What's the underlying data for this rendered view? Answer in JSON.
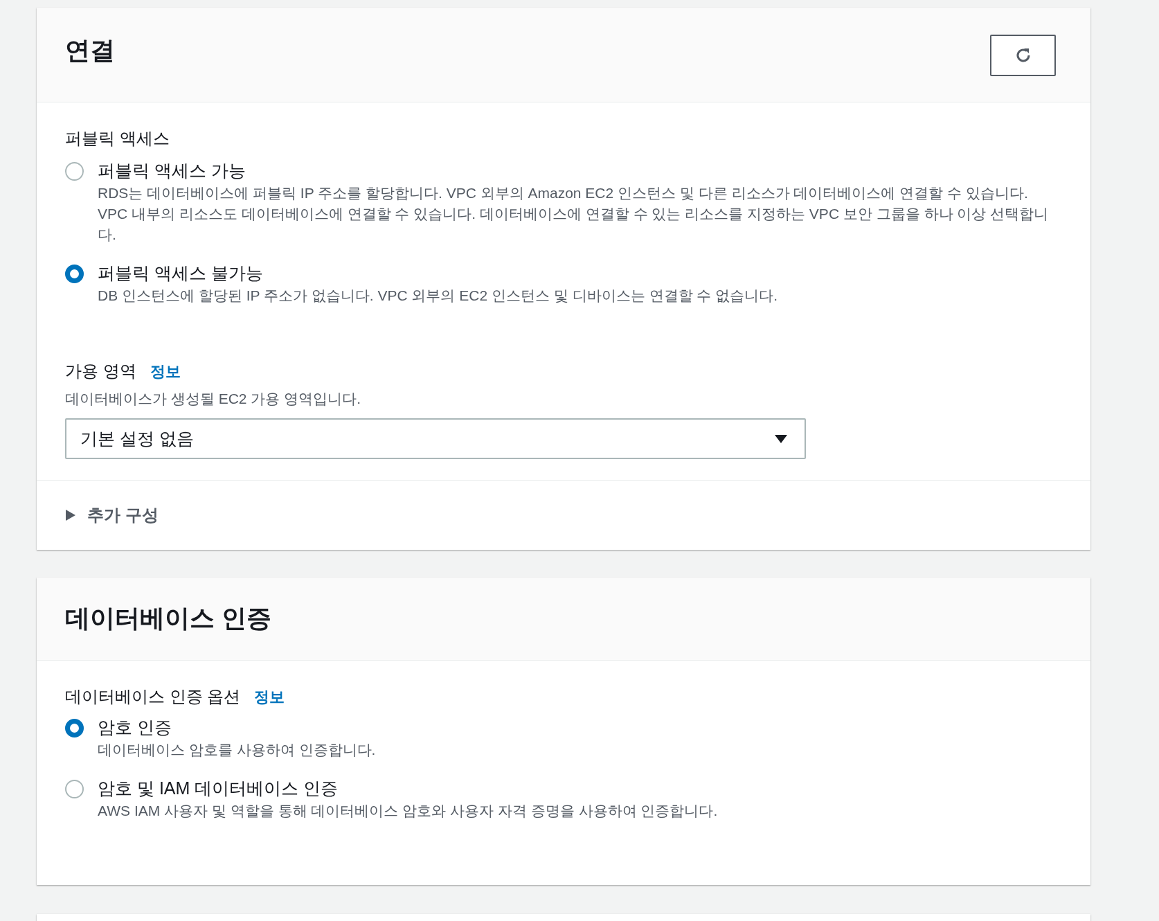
{
  "connection": {
    "title": "연결",
    "public_access": {
      "label": "퍼블릭 액세스",
      "options": [
        {
          "label": "퍼블릭 액세스 가능",
          "description": "RDS는 데이터베이스에 퍼블릭 IP 주소를 할당합니다. VPC 외부의 Amazon EC2 인스턴스 및 다른 리소스가 데이터베이스에 연결할 수 있습니다. VPC 내부의 리소스도 데이터베이스에 연결할 수 있습니다. 데이터베이스에 연결할 수 있는 리소스를 지정하는 VPC 보안 그룹을 하나 이상 선택합니다.",
          "selected": false
        },
        {
          "label": "퍼블릭 액세스 불가능",
          "description": "DB 인스턴스에 할당된 IP 주소가 없습니다. VPC 외부의 EC2 인스턴스 및 디바이스는 연결할 수 없습니다.",
          "selected": true
        }
      ]
    },
    "availability_zone": {
      "label": "가용 영역",
      "info": "정보",
      "description": "데이터베이스가 생성될 EC2 가용 영역입니다.",
      "value": "기본 설정 없음"
    },
    "additional_config": {
      "label": "추가 구성",
      "expanded": false
    }
  },
  "db_auth": {
    "title": "데이터베이스 인증",
    "label": "데이터베이스 인증 옵션",
    "info": "정보",
    "options": [
      {
        "label": "암호 인증",
        "description": "데이터베이스 암호를 사용하여 인증합니다.",
        "selected": true
      },
      {
        "label": "암호 및 IAM 데이터베이스 인증",
        "description": "AWS IAM 사용자 및 역할을 통해 데이터베이스 암호와 사용자 자격 증명을 사용하여 인증합니다.",
        "selected": false
      }
    ]
  }
}
